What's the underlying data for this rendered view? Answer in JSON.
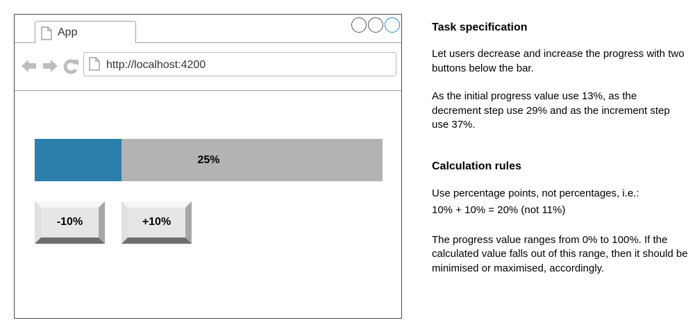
{
  "browser": {
    "tab_title": "App",
    "url": "http://localhost:4200"
  },
  "progress": {
    "value_percent": 25,
    "label": "25%",
    "fill_color": "#2c7eab",
    "track_color": "#b3b3b3"
  },
  "buttons": {
    "decrease_label": "-10%",
    "increase_label": "+10%"
  },
  "spec": {
    "task_heading": "Task specification",
    "task_p1": "Let users decrease and increase the progress with two buttons below the bar.",
    "task_p2": "As the initial progress value use 13%, as the decrement step use 29% and as the increment step use 37%.",
    "rules_heading": "Calculation rules",
    "rules_p1": "Use percentage points, not percentages, i.e.:",
    "rules_p1_example": "10% + 10% = 20% (not 11%)",
    "rules_p2": "The progress value ranges from 0% to 100%. If the calculated value falls out of this range, then it should be minimised or maximised, accordingly."
  },
  "icons": [
    "document-icon",
    "back-arrow-icon",
    "forward-arrow-icon",
    "reload-icon",
    "window-button-icon"
  ]
}
